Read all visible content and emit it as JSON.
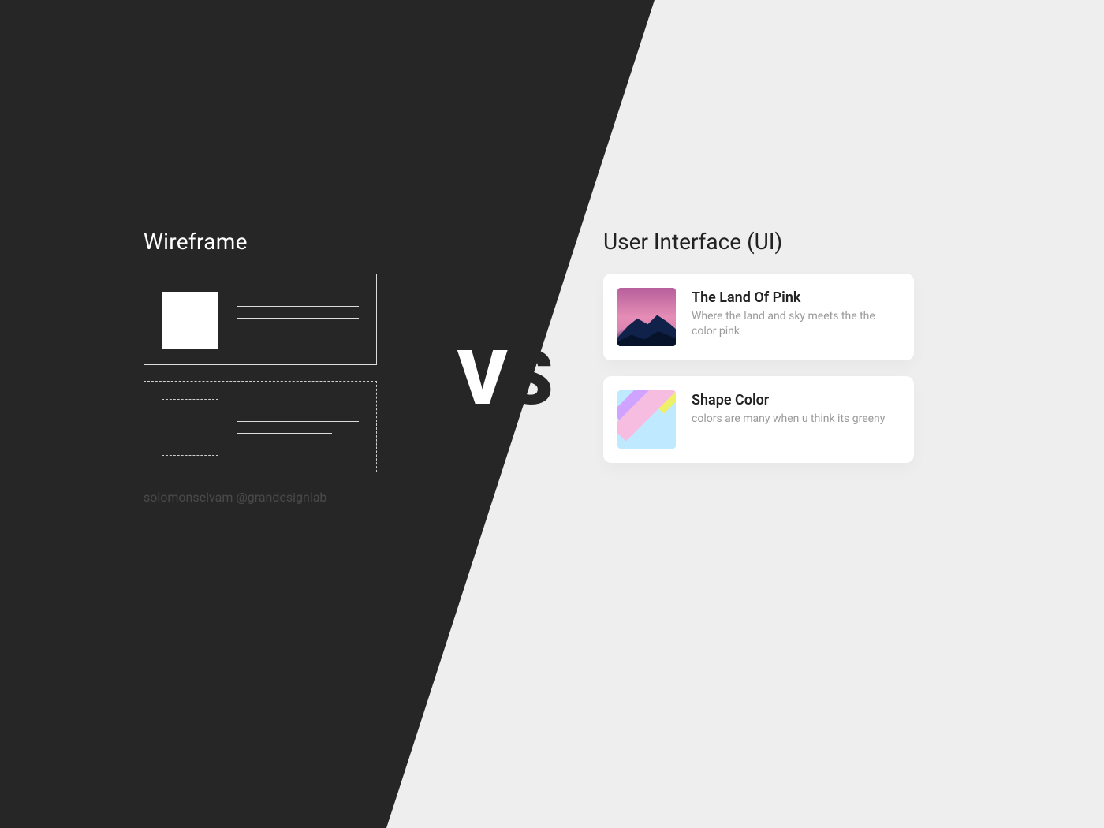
{
  "left": {
    "title": "Wireframe",
    "credit": "solomonselvam @grandesignlab"
  },
  "vs": {
    "v": "V",
    "s": "S"
  },
  "right": {
    "title": "User Interface (UI)",
    "cards": [
      {
        "title": "The Land Of Pink",
        "desc": "Where the land and sky meets the the color pink"
      },
      {
        "title": "Shape Color",
        "desc": "colors are many when u think its greeny"
      }
    ]
  },
  "colors": {
    "dark": "#262626",
    "light": "#eeeeee"
  }
}
